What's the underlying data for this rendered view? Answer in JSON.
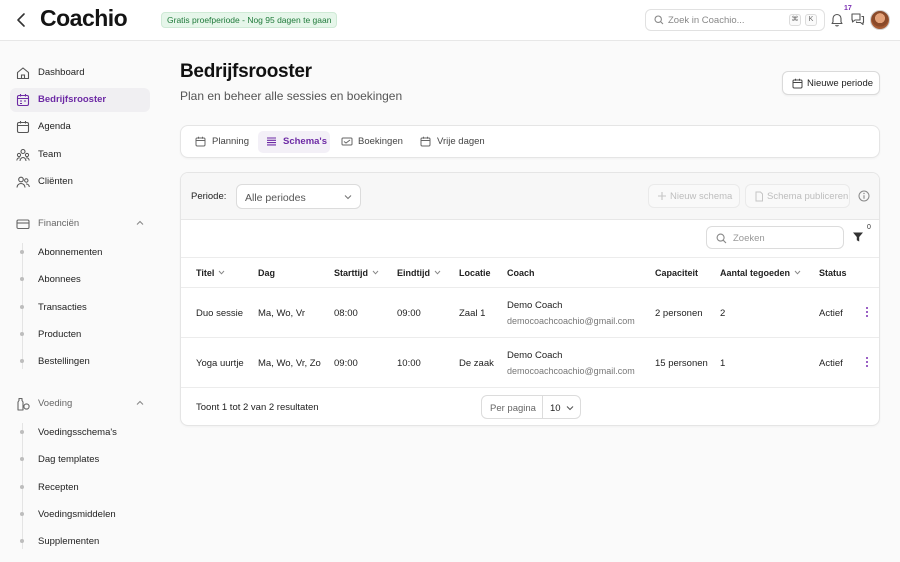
{
  "header": {
    "logo": "Coachio",
    "trial_badge": "Gratis proefperiode - Nog 95 dagen te gaan",
    "search_placeholder": "Zoek in Coachio...",
    "shortcut_keys": [
      "⌘",
      "K"
    ],
    "notification_count": "17"
  },
  "sidebar": {
    "items": [
      {
        "label": "Dashboard",
        "icon": "home-icon"
      },
      {
        "label": "Bedrijfsrooster",
        "icon": "calendar-icon",
        "active": true
      },
      {
        "label": "Agenda",
        "icon": "calendar-icon"
      },
      {
        "label": "Team",
        "icon": "team-icon"
      },
      {
        "label": "Cliënten",
        "icon": "users-icon"
      }
    ],
    "groups": [
      {
        "label": "Financiën",
        "icon": "credit-card-icon",
        "expanded": true,
        "items": [
          "Abonnementen",
          "Abonnees",
          "Transacties",
          "Producten",
          "Bestellingen"
        ]
      },
      {
        "label": "Voeding",
        "icon": "bottle-icon",
        "expanded": true,
        "items": [
          "Voedingsschema's",
          "Dag templates",
          "Recepten",
          "Voedingsmiddelen",
          "Supplementen"
        ]
      }
    ]
  },
  "page": {
    "title": "Bedrijfsrooster",
    "subtitle": "Plan en beheer alle sessies en boekingen",
    "new_period_label": "Nieuwe periode"
  },
  "tabs": [
    {
      "label": "Planning",
      "icon": "calendar-icon"
    },
    {
      "label": "Schema's",
      "icon": "list-icon",
      "active": true
    },
    {
      "label": "Boekingen",
      "icon": "ticket-icon"
    },
    {
      "label": "Vrije dagen",
      "icon": "calendar-icon"
    }
  ],
  "filters": {
    "periode_label": "Periode:",
    "periode_value": "Alle periodes",
    "new_schema_label": "Nieuw schema",
    "publish_label": "Schema publiceren",
    "search_placeholder": "Zoeken",
    "filter_count": "0"
  },
  "table": {
    "columns": [
      "Titel",
      "Dag",
      "Starttijd",
      "Eindtijd",
      "Locatie",
      "Coach",
      "Capaciteit",
      "Aantal tegoeden",
      "Status"
    ],
    "rows": [
      {
        "titel": "Duo sessie",
        "dag": "Ma, Wo, Vr",
        "start": "08:00",
        "eind": "09:00",
        "locatie": "Zaal 1",
        "coach_name": "Demo Coach",
        "coach_email": "democoachcoachio@gmail.com",
        "capaciteit": "2 personen",
        "tegoeden": "2",
        "status": "Actief"
      },
      {
        "titel": "Yoga uurtje",
        "dag": "Ma, Wo, Vr, Zo",
        "start": "09:00",
        "eind": "10:00",
        "locatie": "De zaak",
        "coach_name": "Demo Coach",
        "coach_email": "democoachcoachio@gmail.com",
        "capaciteit": "15 personen",
        "tegoeden": "1",
        "status": "Actief"
      }
    ],
    "footer_text": "Toont 1 tot 2 van 2 resultaten",
    "per_page_label": "Per pagina",
    "per_page_value": "10"
  },
  "colors": {
    "accent": "#6d2aa5",
    "trial_bg": "#e6f6ea",
    "trial_text": "#1f7a3a"
  }
}
